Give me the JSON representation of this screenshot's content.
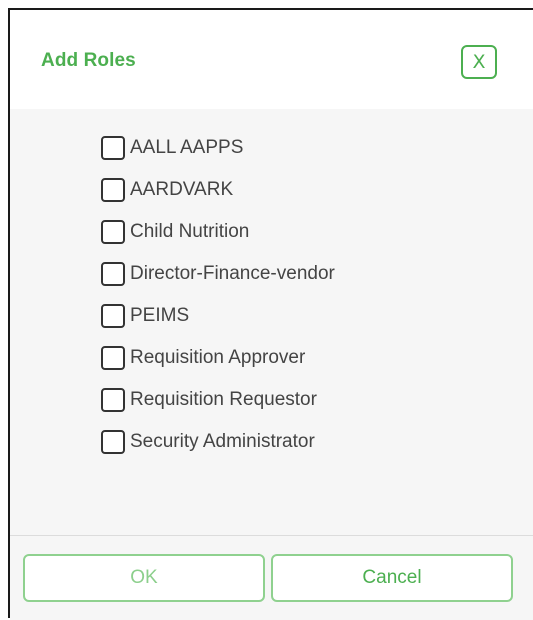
{
  "dialog": {
    "title": "Add Roles",
    "close_label": "X"
  },
  "roles": [
    {
      "label": "AALL AAPPS",
      "checked": false
    },
    {
      "label": "AARDVARK",
      "checked": false
    },
    {
      "label": "Child Nutrition",
      "checked": false
    },
    {
      "label": "Director-Finance-vendor",
      "checked": false
    },
    {
      "label": "PEIMS",
      "checked": false
    },
    {
      "label": "Requisition Approver",
      "checked": false
    },
    {
      "label": "Requisition Requestor",
      "checked": false
    },
    {
      "label": "Security Administrator",
      "checked": false
    }
  ],
  "footer": {
    "ok_label": "OK",
    "cancel_label": "Cancel"
  },
  "colors": {
    "accent": "#4caf50",
    "border_light": "#8fd18f",
    "body_bg": "#f6f6f6"
  }
}
